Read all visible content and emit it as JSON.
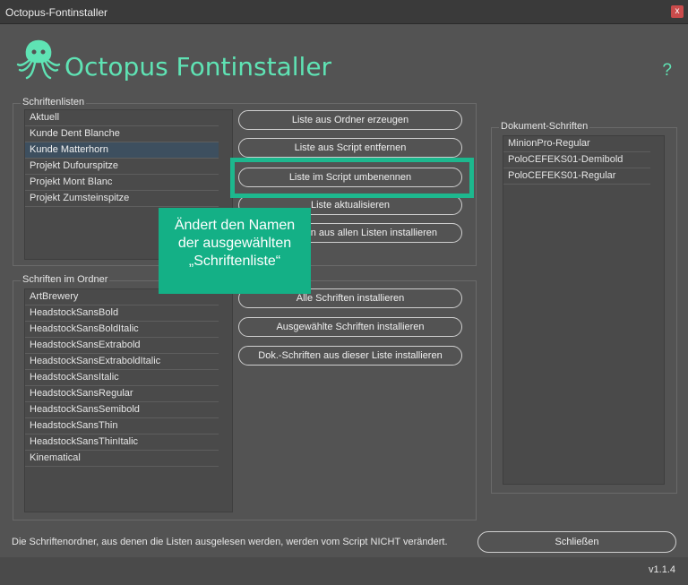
{
  "window": {
    "title": "Octopus-Fontinstaller",
    "close_glyph": "x"
  },
  "header": {
    "title": "Octopus Fontinstaller",
    "help": "?",
    "logo_icon": "octopus-icon"
  },
  "colors": {
    "accent": "#5fe3b4",
    "highlight": "#1db88e",
    "tooltip_bg": "#14b086"
  },
  "schriftenlisten": {
    "label": "Schriftenlisten",
    "items": [
      "Aktuell",
      "Kunde Dent Blanche",
      "Kunde Matterhorn",
      "Projekt Dufourspitze",
      "Projekt Mont Blanc",
      "Projekt Zumsteinspitze"
    ],
    "selected": "Kunde Matterhorn"
  },
  "buttons_top": [
    "Liste aus Ordner erzeugen",
    "Liste aus Script entfernen",
    "Liste im Script umbenennen",
    "Liste aktualisieren",
    "Schriften aus allen Listen installieren"
  ],
  "buttons_visible": {
    "aktualisieren": "Liste aktualisieren",
    "alle_listen_partial": "en aus allen Listen installieren"
  },
  "schriften_ordner": {
    "label": "Schriften im Ordner",
    "items": [
      "ArtBrewery",
      "HeadstockSansBold",
      "HeadstockSansBoldItalic",
      "HeadstockSansExtrabold",
      "HeadstockSansExtraboldItalic",
      "HeadstockSansItalic",
      "HeadstockSansRegular",
      "HeadstockSansSemibold",
      "HeadstockSansThin",
      "HeadstockSansThinItalic",
      "Kinematical"
    ]
  },
  "buttons_bottom": [
    "Alle Schriften installieren",
    "Ausgewählte Schriften installieren",
    "Dok.-Schriften aus dieser Liste installieren"
  ],
  "dokument_schriften": {
    "label": "Dokument-Schriften",
    "items": [
      "MinionPro-Regular",
      "PoloCEFEKS01-Demibold",
      "PoloCEFEKS01-Regular"
    ]
  },
  "tooltip": {
    "lines": [
      "Ändert den Namen",
      "der ausgewählten",
      "„Schriftenliste“"
    ]
  },
  "footer": {
    "note": "Die Schriftenordner, aus denen die Listen ausgelesen werden, werden vom Script NICHT verändert.",
    "close_label": "Schließen",
    "version": "v1.1.4"
  }
}
